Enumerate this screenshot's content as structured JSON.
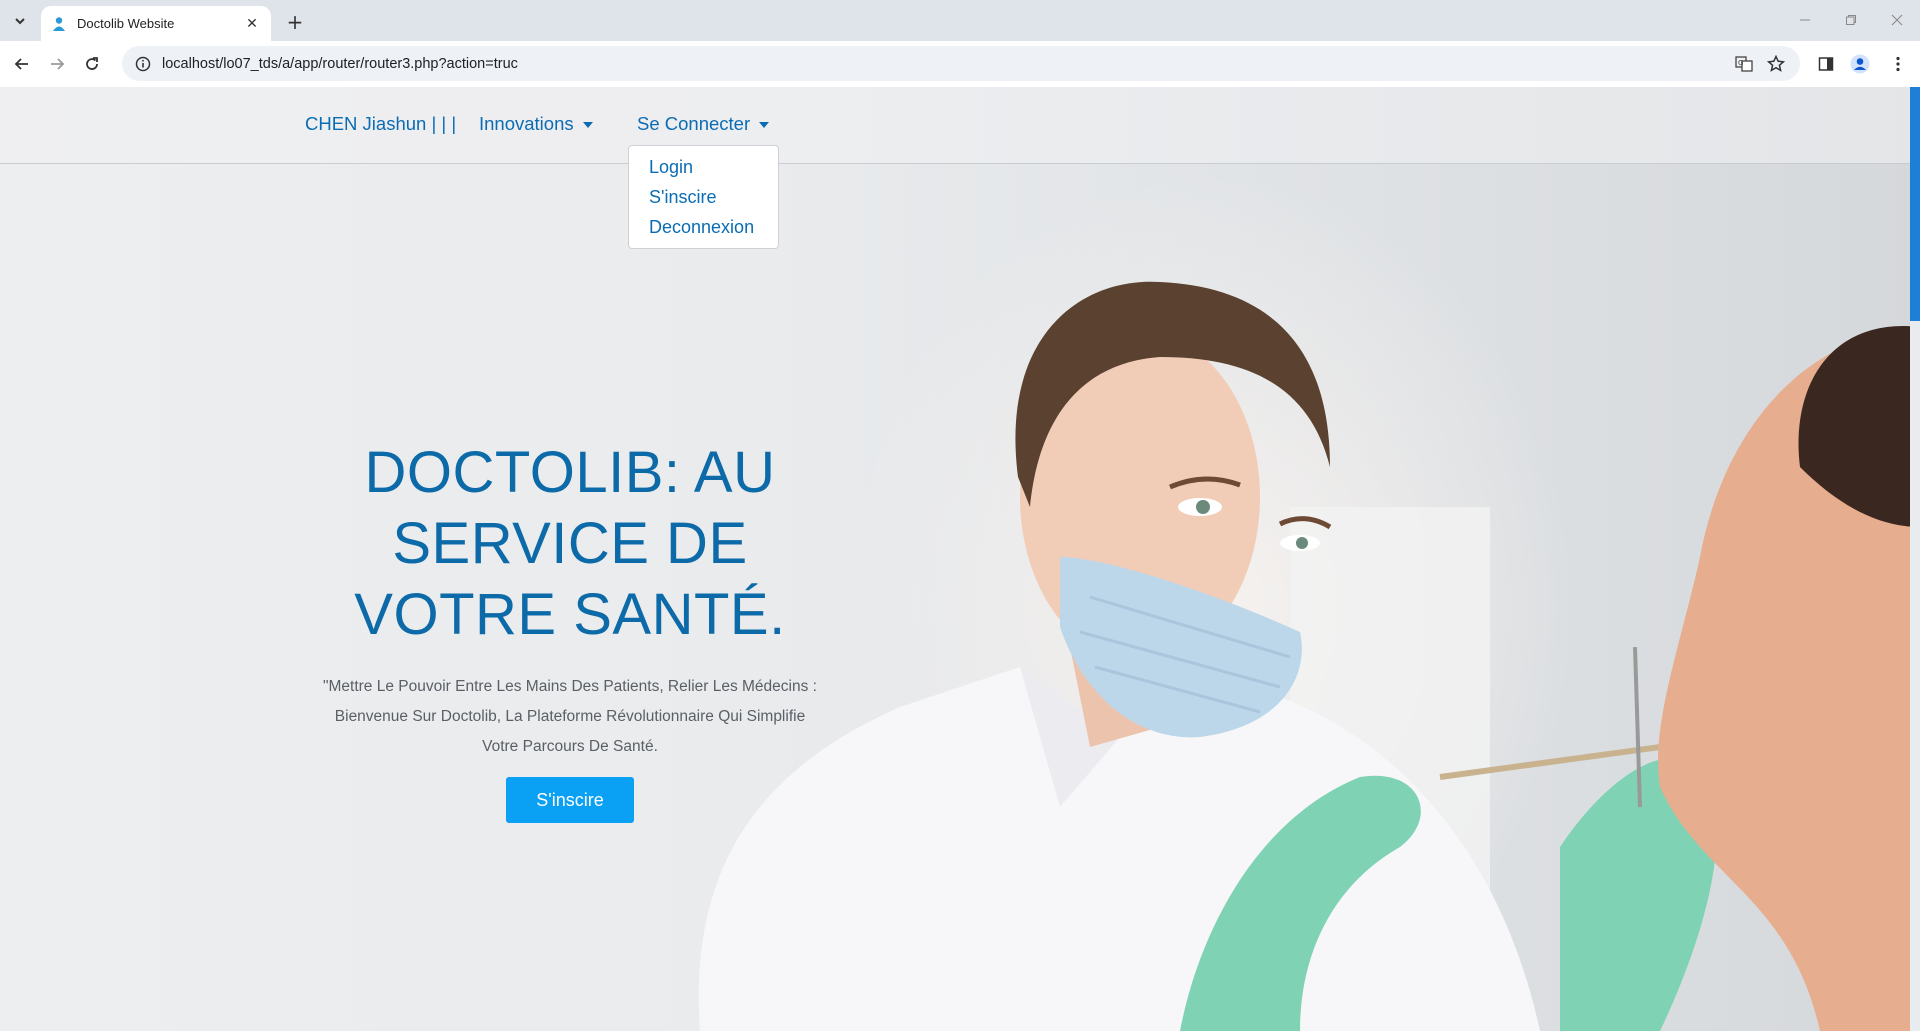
{
  "browser": {
    "tab_title": "Doctolib Website",
    "url": "localhost/lo07_tds/a/app/router/router3.php?action=truc",
    "new_tab_symbol": "+",
    "tab_close_symbol": "✕"
  },
  "navbar": {
    "brand": "CHEN Jiashun | | |",
    "menu_innovations": "Innovations",
    "menu_connect": "Se Connecter"
  },
  "dropdown": {
    "items": [
      "Login",
      "S'inscire",
      "Deconnexion"
    ]
  },
  "hero": {
    "title_line1": "DOCTOLIB: AU",
    "title_line2": "SERVICE DE",
    "title_line3": "VOTRE SANTÉ.",
    "sub_line1": "\"Mettre Le Pouvoir Entre Les Mains Des Patients, Relier Les Médecins :",
    "sub_line2": "Bienvenue Sur Doctolib, La Plateforme Révolutionnaire Qui Simplifie",
    "sub_line3": "Votre Parcours De Santé.",
    "button_label": "S'inscire"
  },
  "colors": {
    "link": "#0b6cb3",
    "title": "#0d6aa8",
    "button": "#0aa1f5",
    "scroll_thumb": "#1d7fd6"
  },
  "icons": [
    "tab-search-icon",
    "favicon-icon",
    "close-icon",
    "plus-icon",
    "minimize-icon",
    "restore-icon",
    "window-close-icon",
    "back-arrow-icon",
    "forward-arrow-icon",
    "reload-icon",
    "site-info-icon",
    "translate-icon",
    "star-icon",
    "side-panel-icon",
    "profile-icon",
    "kebab-menu-icon"
  ]
}
